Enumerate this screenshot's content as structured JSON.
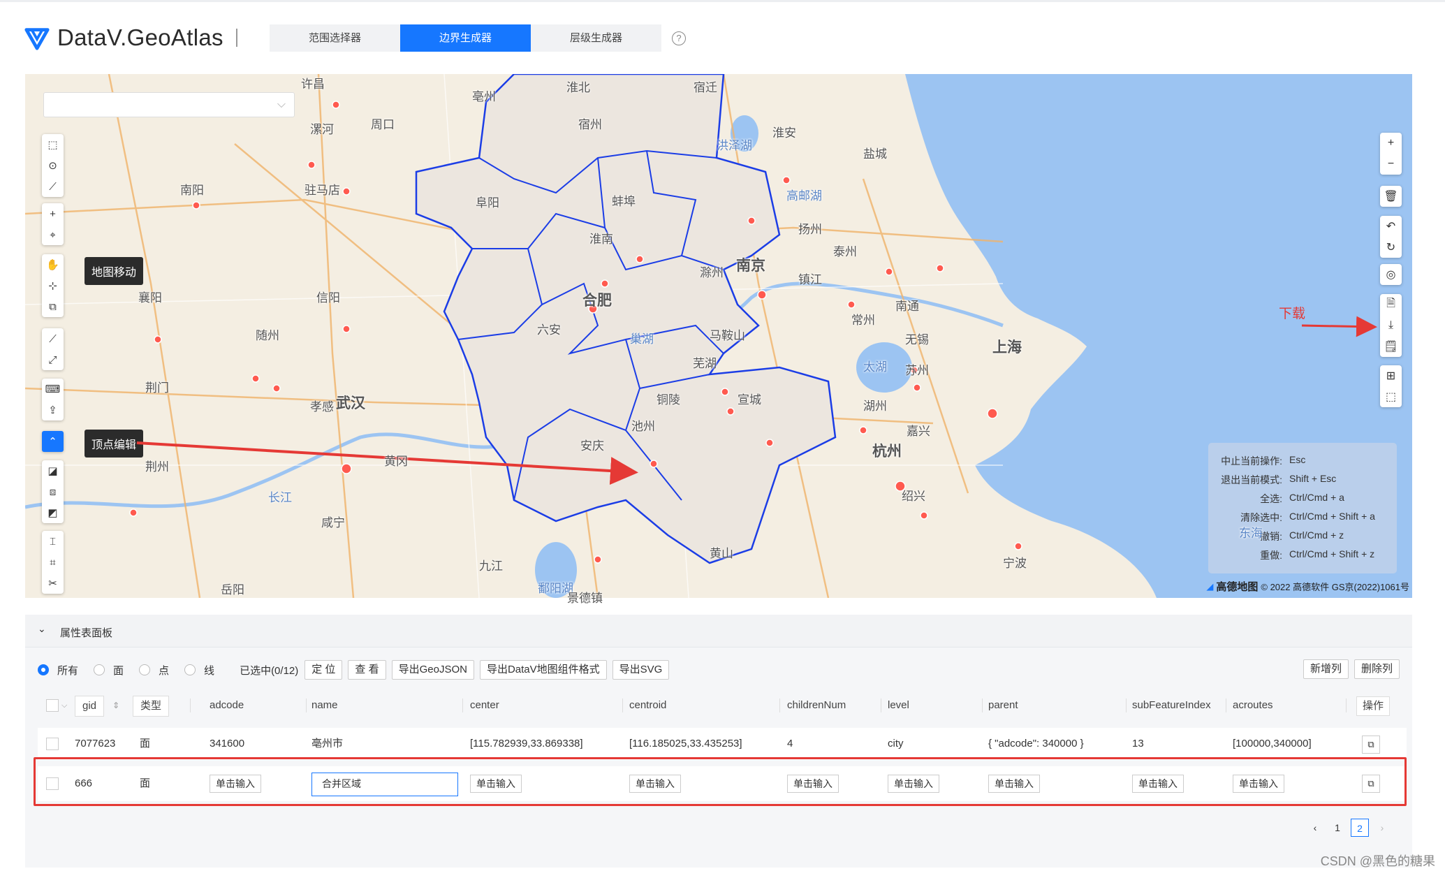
{
  "app": {
    "title": "DataV.GeoAtlas"
  },
  "tabs": [
    {
      "label": "范围选择器"
    },
    {
      "label": "边界生成器"
    },
    {
      "label": "层级生成器"
    }
  ],
  "help": "?",
  "map": {
    "labels": [
      "许昌",
      "亳州",
      "淮北",
      "宿迁",
      "漯河",
      "周口",
      "宿州",
      "淮安",
      "洪泽湖",
      "盐城",
      "南阳",
      "驻马店",
      "阜阳",
      "蚌埠",
      "高邮湖",
      "扬州",
      "泰州",
      "淮南",
      "滁州",
      "南京",
      "镇江",
      "襄阳",
      "信阳",
      "六安",
      "合肥",
      "常州",
      "南通",
      "随州",
      "巢湖",
      "马鞍山",
      "无锡",
      "上海",
      "太湖",
      "苏州",
      "芜湖",
      "荆门",
      "孝感",
      "铜陵",
      "宣城",
      "武汉",
      "湖州",
      "嘉兴",
      "池州",
      "安庆",
      "杭州",
      "荆州",
      "黄冈",
      "绍兴",
      "长江",
      "咸宁",
      "黄山",
      "宁波",
      "九江",
      "岳阳",
      "鄱阳湖",
      "景德镇",
      "东海"
    ],
    "tooltips": {
      "pan": "地图移动",
      "vertex": "顶点编辑"
    },
    "download_annotation": "下载",
    "shortcuts": [
      {
        "k": "中止当前操作:",
        "v": "Esc"
      },
      {
        "k": "退出当前模式:",
        "v": "Shift + Esc"
      },
      {
        "k": "全选:",
        "v": "Ctrl/Cmd + a"
      },
      {
        "k": "清除选中:",
        "v": "Ctrl/Cmd + Shift + a"
      },
      {
        "k": "撤销:",
        "v": "Ctrl/Cmd + z"
      },
      {
        "k": "重做:",
        "v": "Ctrl/Cmd + Shift + z"
      }
    ],
    "copyright_brand": "高德地图",
    "copyright": "© 2022 高德软件 GS京(2022)1061号"
  },
  "panel": {
    "title": "属性表面板",
    "filters": [
      "所有",
      "面",
      "点",
      "线"
    ],
    "selected": "已选中(0/12)",
    "buttons": [
      "定 位",
      "查 看",
      "导出GeoJSON",
      "导出DataV地图组件格式",
      "导出SVG"
    ],
    "right_buttons": [
      "新增列",
      "删除列"
    ],
    "columns": [
      "gid",
      "类型",
      "adcode",
      "name",
      "center",
      "centroid",
      "childrenNum",
      "level",
      "parent",
      "subFeatureIndex",
      "acroutes",
      "操作"
    ],
    "rows": [
      {
        "gid": "7077623",
        "type": "面",
        "adcode": "341600",
        "name": "亳州市",
        "center": "[115.782939,33.869338]",
        "centroid": "[116.185025,33.435253]",
        "childrenNum": "4",
        "level": "city",
        "parent": "{ \"adcode\": 340000 }",
        "subFeatureIndex": "13",
        "acroutes": "[100000,340000]"
      },
      {
        "gid": "666",
        "type": "面",
        "placeholder": "单击输入",
        "name": "合并区域"
      }
    ],
    "pages": [
      "1",
      "2"
    ]
  },
  "watermark": "CSDN @黑色的糖果"
}
